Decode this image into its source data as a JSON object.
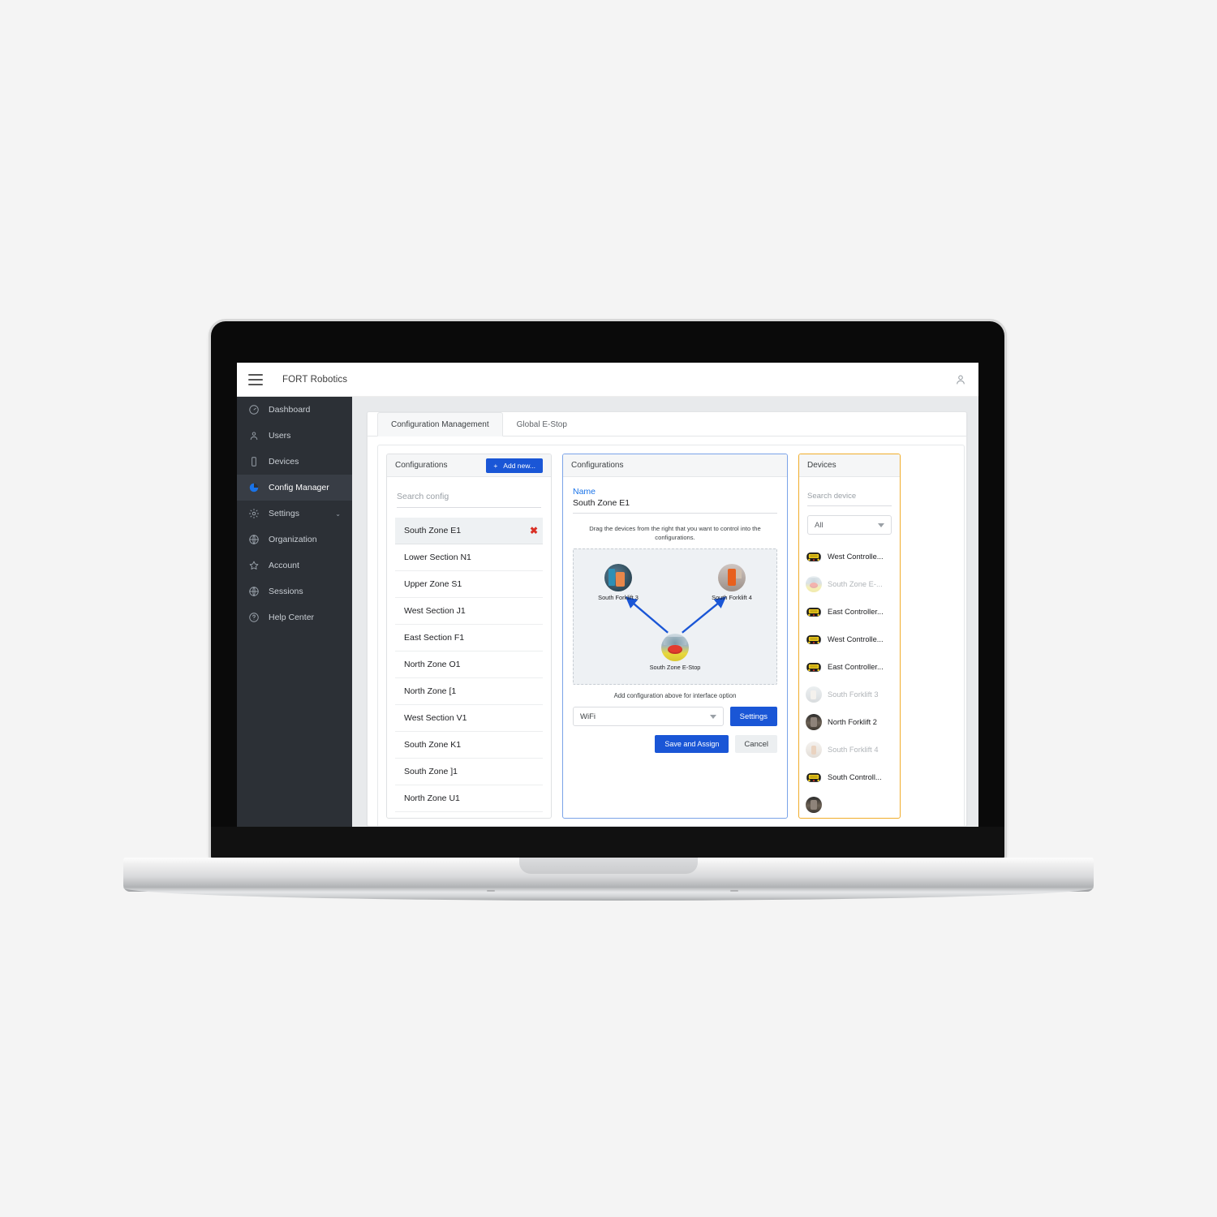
{
  "app": {
    "brand": "FORT Robotics",
    "menu_icon": "hamburger-icon",
    "user_icon": "account-icon"
  },
  "sidebar": {
    "items": [
      {
        "label": "Dashboard",
        "icon": "speedometer-icon",
        "active": false,
        "chevron": ""
      },
      {
        "label": "Users",
        "icon": "users-icon",
        "active": false,
        "chevron": ""
      },
      {
        "label": "Devices",
        "icon": "device-icon",
        "active": false,
        "chevron": ""
      },
      {
        "label": "Config Manager",
        "icon": "pie-chart-icon",
        "active": true,
        "chevron": ""
      },
      {
        "label": "Settings",
        "icon": "gear-icon",
        "active": false,
        "chevron": "⌄"
      },
      {
        "label": "Organization",
        "icon": "globe-icon",
        "active": false,
        "chevron": ""
      },
      {
        "label": "Account",
        "icon": "star-icon",
        "active": false,
        "chevron": ""
      },
      {
        "label": "Sessions",
        "icon": "globe-icon",
        "active": false,
        "chevron": ""
      },
      {
        "label": "Help Center",
        "icon": "help-circle-icon",
        "active": false,
        "chevron": ""
      }
    ]
  },
  "tabs": [
    {
      "label": "Configuration Management",
      "active": true
    },
    {
      "label": "Global E-Stop",
      "active": false
    }
  ],
  "configurations_pane": {
    "title": "Configurations",
    "add_button": "Add new...",
    "add_icon": "plus-icon",
    "search_placeholder": "Search config",
    "search_value": "",
    "items": [
      {
        "name": "South Zone E1",
        "selected": true,
        "delete_icon": "close-x-icon"
      },
      {
        "name": "Lower Section N1",
        "selected": false,
        "delete_icon": ""
      },
      {
        "name": "Upper Zone S1",
        "selected": false,
        "delete_icon": ""
      },
      {
        "name": "West Section J1",
        "selected": false,
        "delete_icon": ""
      },
      {
        "name": "East Section F1",
        "selected": false,
        "delete_icon": ""
      },
      {
        "name": "North Zone O1",
        "selected": false,
        "delete_icon": ""
      },
      {
        "name": "North Zone [1",
        "selected": false,
        "delete_icon": ""
      },
      {
        "name": "West Section V1",
        "selected": false,
        "delete_icon": ""
      },
      {
        "name": "South Zone K1",
        "selected": false,
        "delete_icon": ""
      },
      {
        "name": "South Zone ]1",
        "selected": false,
        "delete_icon": ""
      },
      {
        "name": "North Zone U1",
        "selected": false,
        "delete_icon": ""
      }
    ]
  },
  "detail_pane": {
    "title": "Configurations",
    "name_label": "Name",
    "name_value": "South Zone E1",
    "drag_hint": "Drag the devices from the right that you want to control into the configurations.",
    "nodes": [
      {
        "label": "South Forklift 3",
        "thumb": "t-forklift-blue",
        "role": "target"
      },
      {
        "label": "South Forklift 4",
        "thumb": "t-forklift-orange",
        "role": "target"
      },
      {
        "label": "South Zone E-Stop",
        "thumb": "t-estop",
        "role": "source"
      }
    ],
    "arrow_color": "#1a56d6",
    "interface_hint": "Add configuration above for interface option",
    "interface_value": "WiFi",
    "settings_button": "Settings",
    "save_button": "Save and Assign",
    "cancel_button": "Cancel"
  },
  "devices_pane": {
    "title": "Devices",
    "search_placeholder": "Search device",
    "search_value": "",
    "filter_value": "All",
    "items": [
      {
        "name": "West Controlle...",
        "thumb": "t-controller",
        "dimmed": false
      },
      {
        "name": "South Zone E-...",
        "thumb": "t-estop",
        "dimmed": true
      },
      {
        "name": "East Controller...",
        "thumb": "t-controller",
        "dimmed": false
      },
      {
        "name": "West Controlle...",
        "thumb": "t-controller",
        "dimmed": false
      },
      {
        "name": "East Controller...",
        "thumb": "t-controller",
        "dimmed": false
      },
      {
        "name": "South Forklift 3",
        "thumb": "t-forklift-grey",
        "dimmed": true
      },
      {
        "name": "North Forklift 2",
        "thumb": "t-forklift-dark",
        "dimmed": false
      },
      {
        "name": "South Forklift 4",
        "thumb": "t-forklift-tan",
        "dimmed": true
      },
      {
        "name": "South Controll...",
        "thumb": "t-controller",
        "dimmed": false
      },
      {
        "name": "",
        "thumb": "t-forklift-dark",
        "dimmed": false
      }
    ]
  },
  "colors": {
    "accent_blue": "#1a56d6",
    "link_blue": "#1a73e8",
    "danger_red": "#d93025",
    "devices_border": "#f0ad2b",
    "detail_border": "#7aa3e8",
    "sidebar_bg": "#2c3036",
    "page_bg": "#f4f4f4"
  }
}
